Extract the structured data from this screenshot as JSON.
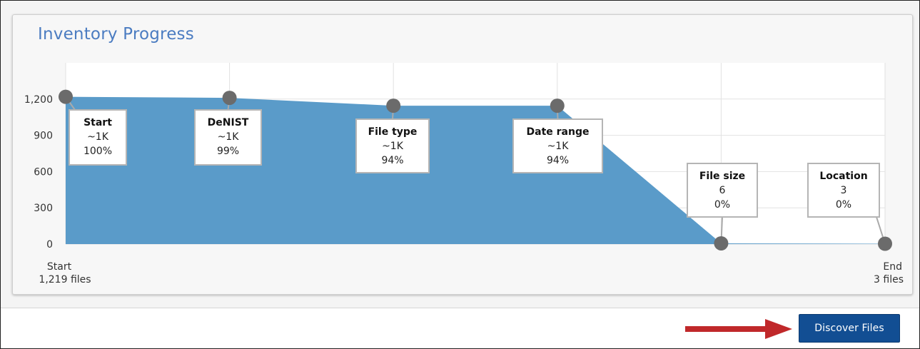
{
  "panel": {
    "title": "Inventory Progress"
  },
  "actions": {
    "discover_label": "Discover Files"
  },
  "colors": {
    "area": "#5a9bc9",
    "marker": "#6b6b6b",
    "accent": "#124e93",
    "arrow": "#c0282a"
  },
  "chart_data": {
    "type": "area",
    "yticks": [
      "0",
      "300",
      "600",
      "900",
      "1,200"
    ],
    "ylim": [
      0,
      1500
    ],
    "grid": true,
    "x_start_label": [
      "Start",
      "1,219 files"
    ],
    "x_end_label": [
      "End",
      "3 files"
    ],
    "steps": [
      {
        "name": "Start",
        "count": "~1K",
        "percent": "100%",
        "value": 1219
      },
      {
        "name": "DeNIST",
        "count": "~1K",
        "percent": "99%",
        "value": 1210
      },
      {
        "name": "File type",
        "count": "~1K",
        "percent": "94%",
        "value": 1145
      },
      {
        "name": "Date range",
        "count": "~1K",
        "percent": "94%",
        "value": 1145
      },
      {
        "name": "File size",
        "count": "6",
        "percent": "0%",
        "value": 6
      },
      {
        "name": "Location",
        "count": "3",
        "percent": "0%",
        "value": 3
      }
    ]
  }
}
